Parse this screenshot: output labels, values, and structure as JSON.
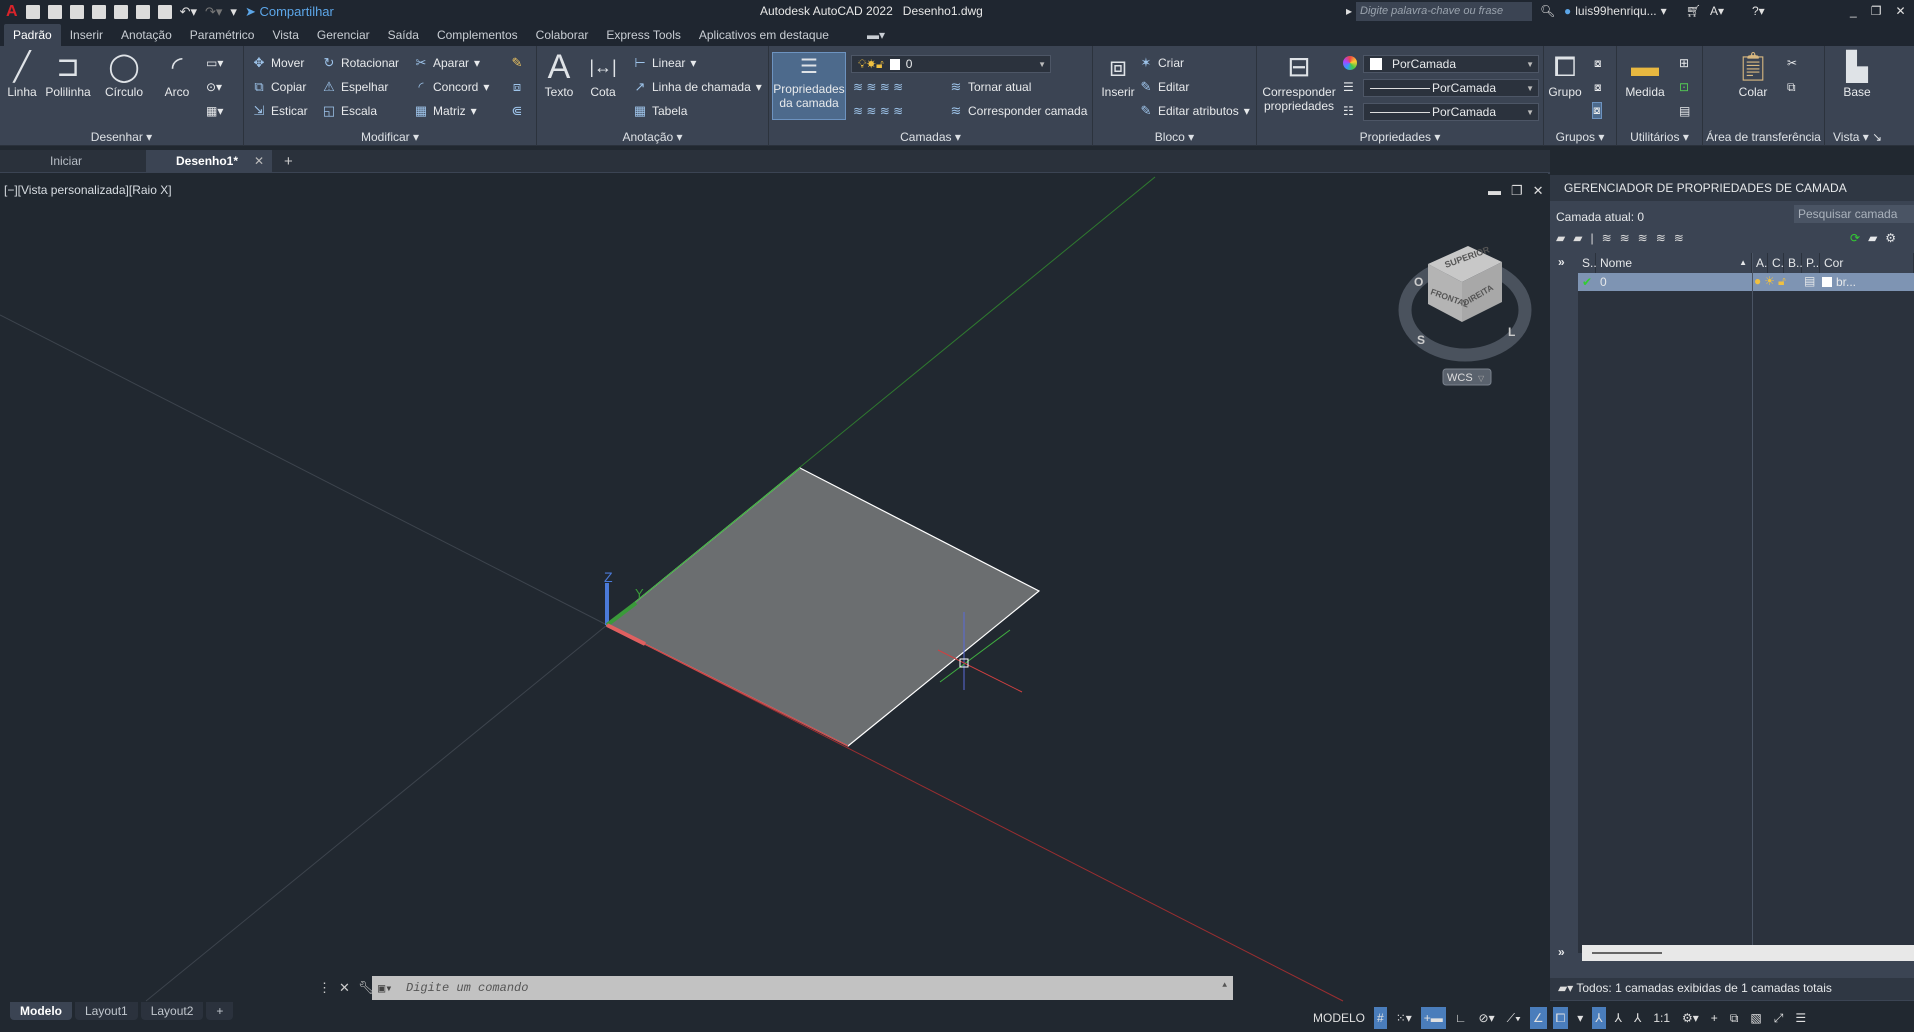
{
  "titlebar": {
    "app_title": "Autodesk AutoCAD 2022",
    "file": "Desenho1.dwg",
    "share": "Compartilhar",
    "search_placeholder": "Digite palavra-chave ou frase",
    "user": "luis99henriqu...",
    "logo": "A"
  },
  "ribbon_tabs": [
    "Padrão",
    "Inserir",
    "Anotação",
    "Paramétrico",
    "Vista",
    "Gerenciar",
    "Saída",
    "Complementos",
    "Colaborar",
    "Express Tools",
    "Aplicativos em destaque"
  ],
  "panels": {
    "desenhar": {
      "title": "Desenhar",
      "linha": "Linha",
      "polilinha": "Polilinha",
      "circulo": "Círculo",
      "arco": "Arco"
    },
    "modificar": {
      "title": "Modificar",
      "mover": "Mover",
      "rotacionar": "Rotacionar",
      "aparar": "Aparar",
      "copiar": "Copiar",
      "espelhar": "Espelhar",
      "concord": "Concord",
      "esticar": "Esticar",
      "escala": "Escala",
      "matriz": "Matriz"
    },
    "anotacao": {
      "title": "Anotação",
      "texto": "Texto",
      "cota": "Cota",
      "linear": "Linear",
      "linha_chamada": "Linha de chamada",
      "tabela": "Tabela"
    },
    "camadas": {
      "title": "Camadas",
      "propriedades1": "Propriedades",
      "propriedades2": "da camada",
      "layer_value": "0",
      "tornar_atual": "Tornar atual",
      "corresponder_camada": "Corresponder camada"
    },
    "bloco": {
      "title": "Bloco",
      "inserir": "Inserir",
      "criar": "Criar",
      "editar": "Editar",
      "editar_atributos": "Editar atributos"
    },
    "propriedades": {
      "title": "Propriedades",
      "corresponder1": "Corresponder",
      "corresponder2": "propriedades",
      "cor": "PorCamada",
      "tipolinha": "PorCamada",
      "espessura": "PorCamada"
    },
    "grupos": {
      "title": "Grupos",
      "grupo": "Grupo"
    },
    "utilitarios": {
      "title": "Utilitários",
      "medida": "Medida"
    },
    "area": {
      "title": "Área de transferência",
      "colar": "Colar"
    },
    "vista": {
      "title": "Vista",
      "base": "Base"
    }
  },
  "doc_tabs": [
    {
      "label": "Iniciar"
    },
    {
      "label": "Desenho1*",
      "active": true
    }
  ],
  "viewport": {
    "label": "[−][Vista personalizada][Raio X]",
    "viewcube": {
      "top": "SUPERIOR",
      "front": "FRONTAL",
      "right": "DIREITA",
      "compass": [
        "O",
        "S",
        "L"
      ],
      "ucs": "WCS"
    },
    "axis_labels": {
      "z": "Z",
      "y": "Y"
    },
    "colors": {
      "x_axis": "#c0393b",
      "y_axis": "#3a9a3a",
      "z_axis": "#4b7ad8",
      "plane": "#6b6e70"
    }
  },
  "layer_panel": {
    "title": "GERENCIADOR DE PROPRIEDADES DE CAMADA",
    "current": "Camada atual: 0",
    "search_placeholder": "Pesquisar camada",
    "columns": [
      "S..",
      "Nome",
      "A.",
      "C.",
      "B..",
      "P..",
      "Cor"
    ],
    "rows": [
      {
        "name": "0",
        "color": "br..."
      }
    ],
    "footer": "Todos: 1 camadas exibidas de 1 camadas totais"
  },
  "command": {
    "placeholder": "Digite um comando"
  },
  "layout_tabs": [
    "Modelo",
    "Layout1",
    "Layout2",
    "+"
  ],
  "status": {
    "model": "MODELO",
    "scale": "1:1"
  }
}
